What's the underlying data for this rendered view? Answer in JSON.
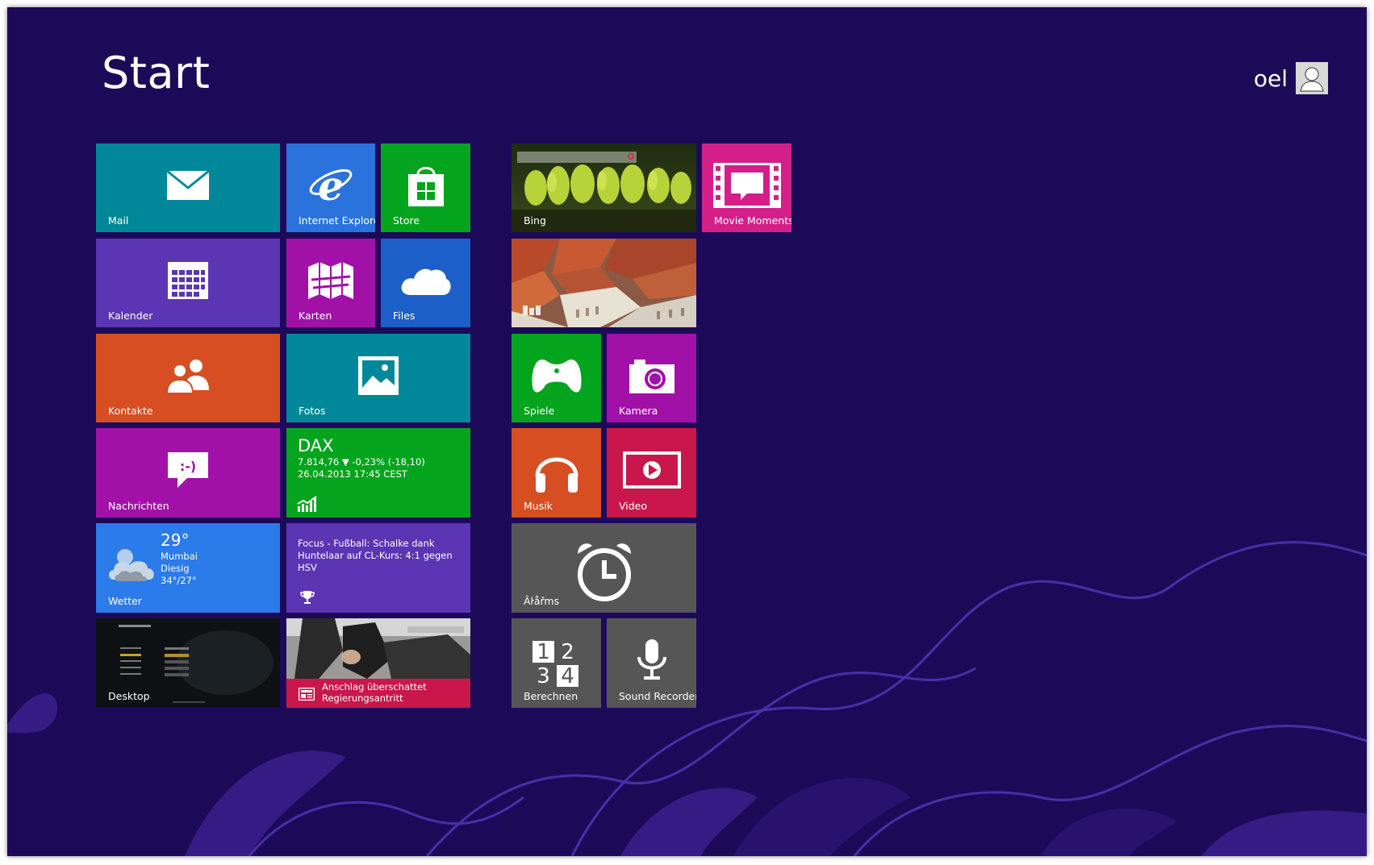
{
  "header": {
    "title": "Start",
    "user_name": "oel"
  },
  "colors": {
    "background": "#1c0a59",
    "teal": "#00889a",
    "blue_ie": "#2a73dc",
    "green": "#05a41e",
    "purple": "#5c35b5",
    "magenta": "#a111a8",
    "blue_files": "#1c5fc8",
    "orange": "#d64e21",
    "pink": "#d41f8a",
    "gray": "#565656",
    "red": "#c9174c",
    "weather_blue": "#2b7bea"
  },
  "tiles": {
    "mail": {
      "label": "Mail",
      "icon": "envelope-icon"
    },
    "ie": {
      "label": "Internet Explorer",
      "icon": "internet-explorer-icon"
    },
    "store": {
      "label": "Store",
      "icon": "store-bag-icon"
    },
    "bing": {
      "label": "Bing",
      "icon": "bing-photo"
    },
    "movie": {
      "label": "Movie Moments",
      "icon": "film-speech-icon"
    },
    "kalender": {
      "label": "Kalender",
      "icon": "calendar-icon"
    },
    "karten": {
      "label": "Karten",
      "icon": "map-icon"
    },
    "files": {
      "label": "Files",
      "icon": "cloud-icon"
    },
    "kontakte": {
      "label": "Kontakte",
      "icon": "people-icon"
    },
    "fotos": {
      "label": "Fotos",
      "icon": "picture-icon"
    },
    "spiele": {
      "label": "Spiele",
      "icon": "gamepad-icon"
    },
    "kamera": {
      "label": "Kamera",
      "icon": "camera-icon"
    },
    "nachrichten": {
      "label": "Nachrichten",
      "icon": "chat-smiley-icon"
    },
    "finance": {
      "title": "DAX",
      "line1": "7.814,76 ▼ -0,23% (-18,10)",
      "line2": "26.04.2013 17:45 CEST",
      "icon": "stock-chart-icon"
    },
    "musik": {
      "label": "Musik",
      "icon": "headphones-icon"
    },
    "video": {
      "label": "Video",
      "icon": "play-icon"
    },
    "wetter": {
      "label": "Wetter",
      "temp": "29°",
      "city": "Mumbai",
      "condition": "Diesig",
      "range": "34°/27°",
      "icon": "cloud-sun-icon"
    },
    "sport": {
      "text": "Focus - Fußball: Schalke dank Huntelaar auf CL-Kurs: 4:1 gegen HSV",
      "icon": "trophy-icon"
    },
    "alarms": {
      "label": "Âŀåřms",
      "icon": "alarm-clock-icon"
    },
    "desktop": {
      "label": "Desktop"
    },
    "news": {
      "text": "Anschlag überschattet Regierungsantritt",
      "icon": "newspaper-icon"
    },
    "calculator": {
      "label": "Berechnen",
      "digits": [
        "1",
        "2",
        "3",
        "4"
      ]
    },
    "recorder": {
      "label": "Sound Recorder",
      "icon": "microphone-icon"
    }
  }
}
